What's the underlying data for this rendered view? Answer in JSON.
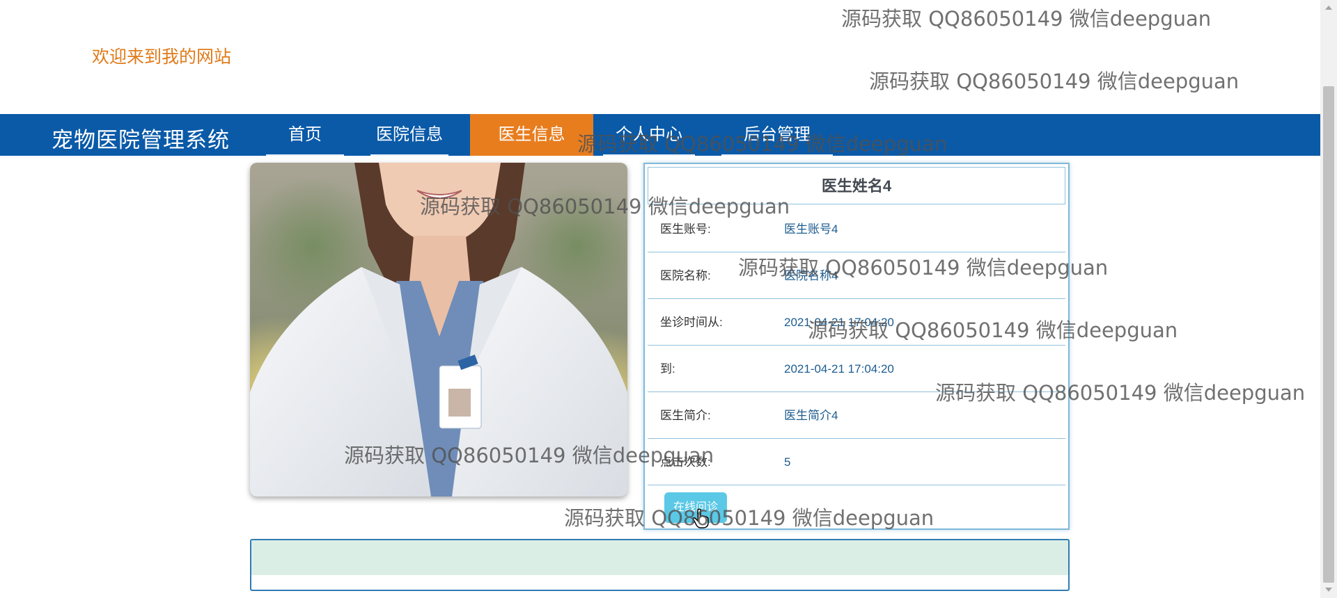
{
  "header": {
    "welcome": "欢迎来到我的网站"
  },
  "nav": {
    "site_title": "宠物医院管理系统",
    "items": [
      {
        "label": "首页"
      },
      {
        "label": "医院信息"
      },
      {
        "label": "医生信息",
        "active": true
      },
      {
        "label": "个人中心"
      },
      {
        "label": "后台管理"
      }
    ]
  },
  "doctor": {
    "name": "医生姓名4",
    "fields": [
      {
        "label": "医生账号:",
        "value": "医生账号4"
      },
      {
        "label": "医院名称:",
        "value": "医院名称4"
      },
      {
        "label": "坐诊时间从:",
        "value": "2021-04-21 17:04:20"
      },
      {
        "label": "到:",
        "value": "2021-04-21 17:04:20"
      },
      {
        "label": "医生简介:",
        "value": "医生简介4"
      },
      {
        "label": "点击次数:",
        "value": "5"
      }
    ],
    "consult_button": "在线问诊",
    "photo": "doctor-photo"
  },
  "watermark": "源码获取 QQ86050149 微信deepguan",
  "colors": {
    "nav_bg": "#0a5aa8",
    "active_tab": "#e87d1e",
    "welcome_text": "#e07b1a",
    "button": "#5bc8e6"
  }
}
